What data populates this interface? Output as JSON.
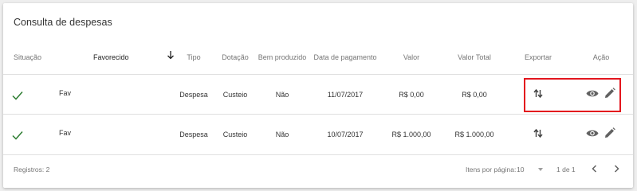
{
  "page": {
    "title": "Consulta de despesas"
  },
  "table": {
    "headers": {
      "situacao": "Situação",
      "favorecido": "Favorecido",
      "tipo": "Tipo",
      "dotacao": "Dotação",
      "bem_produzido": "Bem produzido",
      "data_pagamento": "Data de pagamento",
      "valor": "Valor",
      "valor_total": "Valor Total",
      "exportar": "Exportar",
      "acao": "Ação"
    },
    "sort_icon": "arrow-down-icon",
    "rows": [
      {
        "status_icon": "check-icon",
        "favorecido": "Fav",
        "tipo": "Despesa",
        "dotacao": "Custeio",
        "bem_produzido": "Não",
        "data_pagamento": "11/07/2017",
        "valor": "R$ 0,00",
        "valor_total": "R$ 0,00"
      },
      {
        "status_icon": "check-icon",
        "favorecido": "Fav",
        "tipo": "Despesa",
        "dotacao": "Custeio",
        "bem_produzido": "Não",
        "data_pagamento": "10/07/2017",
        "valor": "R$ 1.000,00",
        "valor_total": "R$ 1.000,00"
      }
    ]
  },
  "footer": {
    "registros": "Registros: 2",
    "itens_por_pagina_label": "Itens por página:",
    "itens_por_pagina_value": "10",
    "page_range": "1 de 1"
  },
  "colors": {
    "check": "#2e7d32",
    "icon": "#616161",
    "highlight": "#e3161e"
  }
}
